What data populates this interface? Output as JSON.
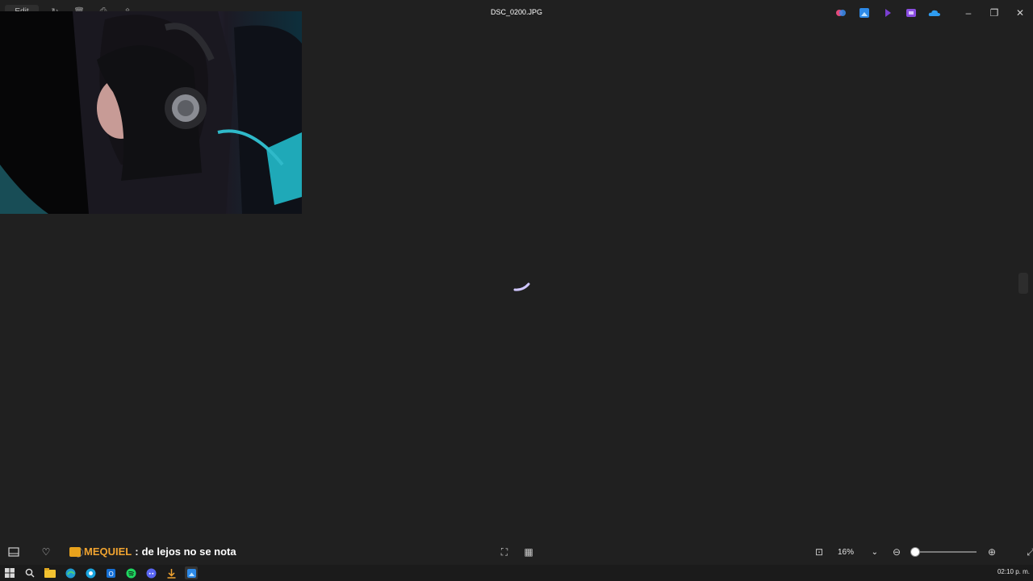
{
  "window": {
    "title": "DSC_0200.JPG",
    "edit_label": "Edit"
  },
  "chat": {
    "username": "MEQUIEL",
    "separator": ":",
    "message": "de lejos no se nota"
  },
  "zoom": {
    "level": "16%"
  },
  "clock": {
    "time": "02:10 p. m."
  },
  "colors": {
    "background": "#202020",
    "username": "#f0a330",
    "accent": "#4aa3ff"
  }
}
